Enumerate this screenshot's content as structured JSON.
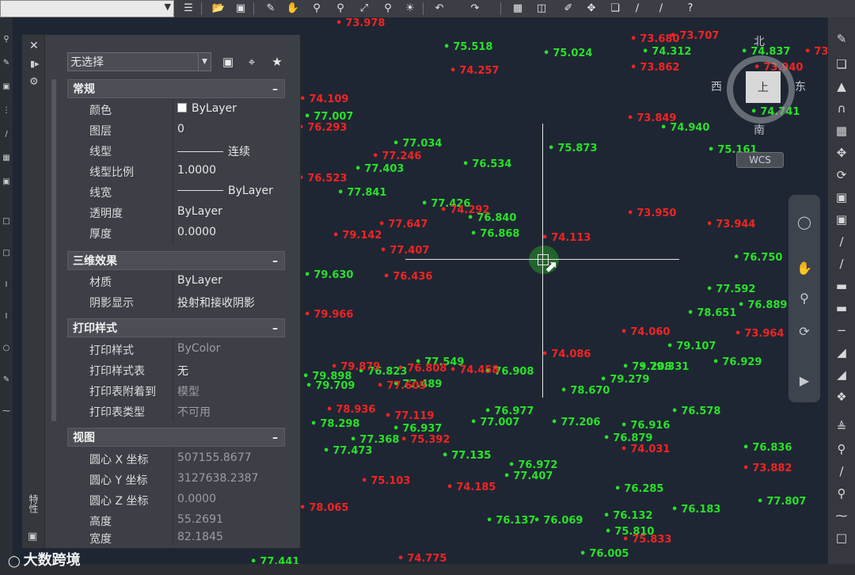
{
  "toolbar": {
    "layer_combo_value": "",
    "icons": [
      "menu-icon",
      "open-icon",
      "save-icon",
      "edit-icon",
      "pan-icon",
      "zoom-icon",
      "zoom-window-icon",
      "zoom-extents-icon",
      "zoom-previous-icon",
      "render-icon",
      "undo-icon",
      "redo-icon",
      "properties-icon",
      "design-center-icon",
      "match-properties-icon",
      "move-icon",
      "copy-icon",
      "trim-icon",
      "extend-icon",
      "help-icon"
    ]
  },
  "properties": {
    "selection": "无选择",
    "sections": [
      {
        "title": "常规",
        "rows": [
          {
            "key": "颜色",
            "value": "ByLayer"
          },
          {
            "key": "图层",
            "value": "0"
          },
          {
            "key": "线型",
            "value": "连续"
          },
          {
            "key": "线型比例",
            "value": "1.0000"
          },
          {
            "key": "线宽",
            "value": "ByLayer"
          },
          {
            "key": "透明度",
            "value": "ByLayer"
          },
          {
            "key": "厚度",
            "value": "0.0000"
          }
        ]
      },
      {
        "title": "三维效果",
        "rows": [
          {
            "key": "材质",
            "value": "ByLayer"
          },
          {
            "key": "阴影显示",
            "value": "投射和接收阴影"
          }
        ]
      },
      {
        "title": "打印样式",
        "rows": [
          {
            "key": "打印样式",
            "value": "ByColor"
          },
          {
            "key": "打印样式表",
            "value": "无"
          },
          {
            "key": "打印表附着到",
            "value": "模型"
          },
          {
            "key": "打印表类型",
            "value": "不可用"
          }
        ]
      },
      {
        "title": "视图",
        "rows": [
          {
            "key": "圆心 X 坐标",
            "value": "507155.8677"
          },
          {
            "key": "圆心 Y 坐标",
            "value": "3127638.2387"
          },
          {
            "key": "圆心 Z 坐标",
            "value": "0.0000"
          },
          {
            "key": "高度",
            "value": "55.2691"
          },
          {
            "key": "宽度",
            "value": "82.1845"
          }
        ]
      }
    ],
    "side_label": "特性"
  },
  "viewcube": {
    "north": "北",
    "south": "南",
    "east": "东",
    "west": "西",
    "top": "上",
    "wcs": "WCS"
  },
  "watermark": "大数跨境",
  "points_green": [
    "75.518",
    "75.024",
    "74.312",
    "74.837",
    "77.007",
    "77.034",
    "75.873",
    "74.940",
    "75.161",
    "77.403",
    "76.534",
    "74.741",
    "77.841",
    "77.426",
    "76.840",
    "76.868",
    "76.750",
    "79.630",
    "77.592",
    "76.889",
    "78.651",
    "79.107",
    "76.929",
    "77.549",
    "79.898",
    "79.709",
    "76.823",
    "76.908",
    "77.489",
    "78.670",
    "79.279",
    "79.208",
    "79.331",
    "76.578",
    "76.977",
    "77.007",
    "77.135",
    "77.206",
    "76.916",
    "76.879",
    "76.937",
    "78.298",
    "77.368",
    "77.473",
    "77.135",
    "76.972",
    "77.407",
    "76.836",
    "76.285",
    "77.807",
    "76.137",
    "76.069",
    "76.132",
    "75.810",
    "76.183",
    "76.005",
    "77.441"
  ],
  "points_red": [
    "73.978",
    "73.680",
    "73.707",
    "74.257",
    "73.862",
    "74.109",
    "73.940",
    "73.849",
    "77.246",
    "73.916",
    "74.292",
    "73.950",
    "77.647",
    "79.142",
    "73.944",
    "77.407",
    "74.113",
    "76.436",
    "79.966",
    "74.060",
    "73.964",
    "74.086",
    "76.808",
    "74.458",
    "79.879",
    "78.936",
    "77.119",
    "77.605",
    "75.392",
    "74.031",
    "75.103",
    "74.185",
    "73.882",
    "78.065",
    "74.775",
    "75.833",
    "76.293",
    "76.523"
  ]
}
